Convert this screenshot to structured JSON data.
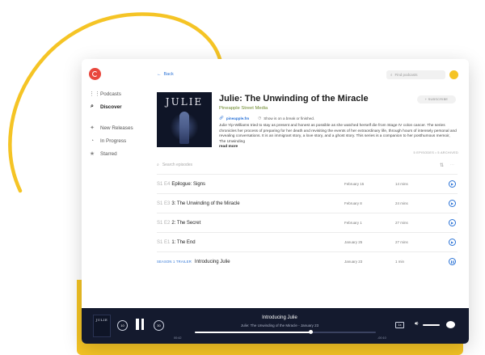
{
  "colors": {
    "accent": "#2b73d6",
    "brand": "#e9473c",
    "decor_yellow": "#f5c425",
    "player_bg": "#141a2e",
    "author_green": "#6e8a2e"
  },
  "sidebar": {
    "items": [
      {
        "label": "Podcasts",
        "icon": "grid-icon"
      },
      {
        "label": "Discover",
        "icon": "search-icon",
        "active": true
      },
      {
        "label": "New Releases",
        "icon": "sparkle-icon"
      },
      {
        "label": "In Progress",
        "icon": "progress-icon"
      },
      {
        "label": "Starred",
        "icon": "star-icon"
      }
    ]
  },
  "header": {
    "back_label": "Back",
    "search_placeholder": "Find podcasts"
  },
  "podcast": {
    "cover_text": "JULIE",
    "title": "Julie: The Unwinding of the Miracle",
    "author": "Pineapple Street Media",
    "subscribe_label": "+ SUBSCRIBE",
    "website": "pineapple.fm",
    "status_note": "Show is on a break or finished.",
    "description": "Julie Yip-Williams tried to stay as present and honest as possible as she watched herself die from Stage IV colon cancer. The series chronicles her process of preparing for her death and revisiting the events of her extraordinary life, through hours of intensely personal and revealing conversations. It is an immigrant story, a love story, and a ghost story. This series is a companion to her posthumous memoir, The Unwinding",
    "read_more": "read more"
  },
  "episodes": {
    "count_text": "5 EPISODES • 5 ARCHIVED",
    "search_placeholder": "Search episodes",
    "list": [
      {
        "number": "S1 E4",
        "title": "Epilogue: Signs",
        "date": "February 15",
        "duration": "14 mins",
        "state": "play"
      },
      {
        "number": "S1 E3",
        "title": "3: The Unwinding of the Miracle",
        "date": "February 8",
        "duration": "24 mins",
        "state": "play"
      },
      {
        "number": "S1 E2",
        "title": "2: The Secret",
        "date": "February 1",
        "duration": "27 mins",
        "state": "play"
      },
      {
        "number": "S1 E1",
        "title": "1: The End",
        "date": "January 25",
        "duration": "27 mins",
        "state": "play"
      },
      {
        "number": "SEASON 1 TRAILER",
        "title": "Introducing Julie",
        "date": "January 23",
        "duration": "1 min",
        "state": "pause",
        "trailer": true
      }
    ]
  },
  "player": {
    "cover_text": "JULIE",
    "title": "Introducing Julie",
    "subtitle": "Julie: The Unwinding of the Miracle - January 23",
    "elapsed": "00:42",
    "remaining": "-00:10",
    "progress": 0.64,
    "skip_back": "10",
    "skip_forward": "30",
    "speed": "1x"
  }
}
